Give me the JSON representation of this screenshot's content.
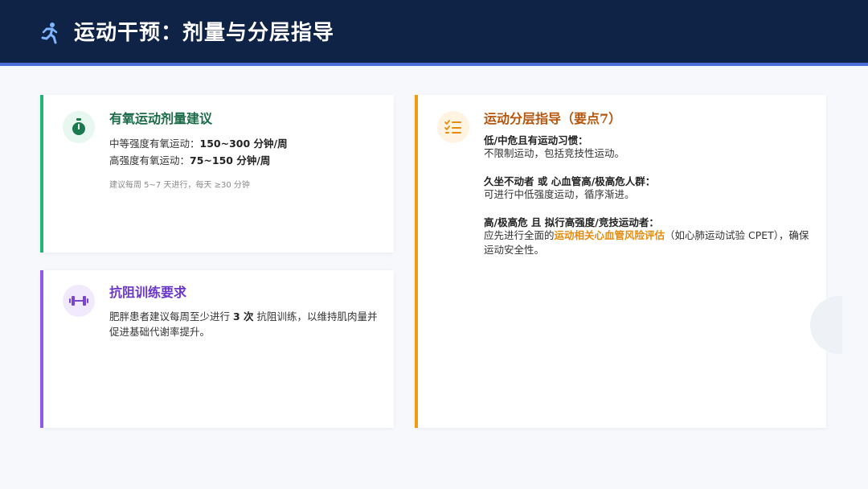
{
  "header": {
    "title": "运动干预：剂量与分层指导"
  },
  "aerobic": {
    "title": "有氧运动剂量建议",
    "moderate_label": "中等强度有氧运动：",
    "moderate_value": "150~300 分钟/周",
    "high_label": "高强度有氧运动：",
    "high_value": "75~150 分钟/周",
    "note": "建议每周 5~7 天进行，每天 ≥30 分钟"
  },
  "resistance": {
    "title": "抗阻训练要求",
    "text_before": "肥胖患者建议每周至少进行 ",
    "text_bold": "3 次",
    "text_after": " 抗阻训练，以维持肌肉量并促进基础代谢率提升。"
  },
  "stratify": {
    "title": "运动分层指导（要点7）",
    "groups": [
      {
        "title": "低/中危且有运动习惯：",
        "body": " 不限制运动，包括竞技性运动。"
      },
      {
        "title": "久坐不动者 或 心血管高/极高危人群：",
        "body": " 可进行中低强度运动，循序渐进。"
      },
      {
        "title": "高/极高危 且 拟行高强度/竞技运动者：",
        "body_before": " 应先进行全面的",
        "body_highlight": "运动相关心血管风险评估",
        "body_after": "（如心肺运动试验 CPET），确保运动安全性。"
      }
    ]
  },
  "colors": {
    "header_bg": "#0f2346",
    "aerobic_accent": "#22b573",
    "resistance_accent": "#8e5ae6",
    "stratify_accent": "#f19a12"
  },
  "icons": {
    "header": "running-person-icon",
    "aerobic": "stopwatch-icon",
    "resistance": "dumbbell-icon",
    "stratify": "checklist-icon"
  }
}
